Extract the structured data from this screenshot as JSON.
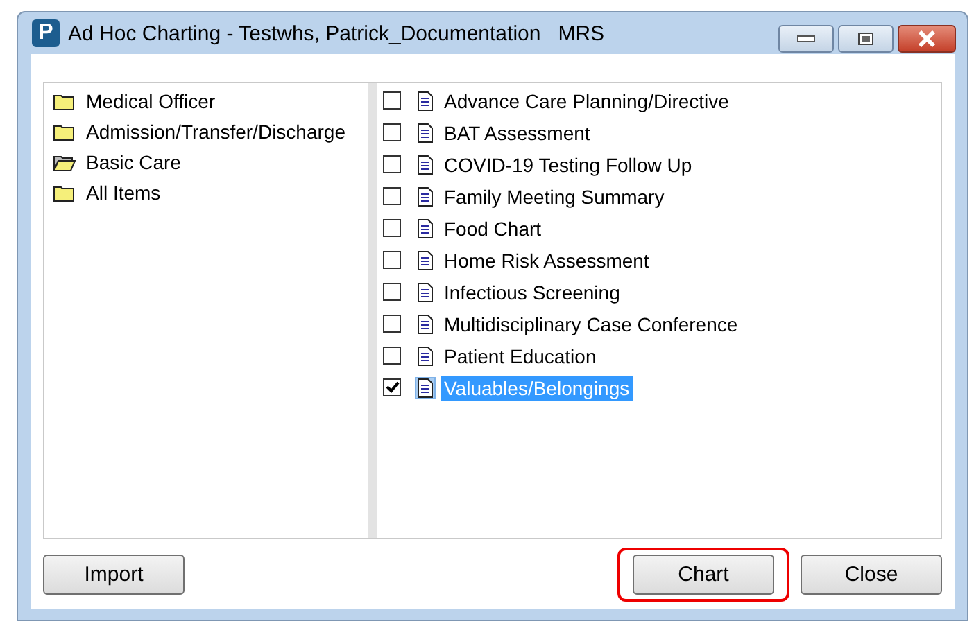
{
  "window": {
    "title": "Ad Hoc Charting - Testwhs, Patrick_Documentation   MRS",
    "app_icon": "P"
  },
  "folders": [
    {
      "label": "Medical Officer",
      "open": false
    },
    {
      "label": "Admission/Transfer/Discharge",
      "open": false
    },
    {
      "label": "Basic Care",
      "open": true
    },
    {
      "label": "All Items",
      "open": false
    }
  ],
  "forms": [
    {
      "label": "Advance Care Planning/Directive",
      "checked": false,
      "selected": false
    },
    {
      "label": "BAT Assessment",
      "checked": false,
      "selected": false
    },
    {
      "label": "COVID-19 Testing Follow Up",
      "checked": false,
      "selected": false
    },
    {
      "label": "Family Meeting Summary",
      "checked": false,
      "selected": false
    },
    {
      "label": "Food Chart",
      "checked": false,
      "selected": false
    },
    {
      "label": "Home Risk Assessment",
      "checked": false,
      "selected": false
    },
    {
      "label": "Infectious Screening",
      "checked": false,
      "selected": false
    },
    {
      "label": "Multidisciplinary Case Conference",
      "checked": false,
      "selected": false
    },
    {
      "label": "Patient Education",
      "checked": false,
      "selected": false
    },
    {
      "label": "Valuables/Belongings",
      "checked": true,
      "selected": true
    }
  ],
  "left_buttons": [
    {
      "label": "Import",
      "highlighted": false
    }
  ],
  "right_buttons": [
    {
      "label": "Chart",
      "highlighted": true
    },
    {
      "label": "Close",
      "highlighted": false
    }
  ]
}
